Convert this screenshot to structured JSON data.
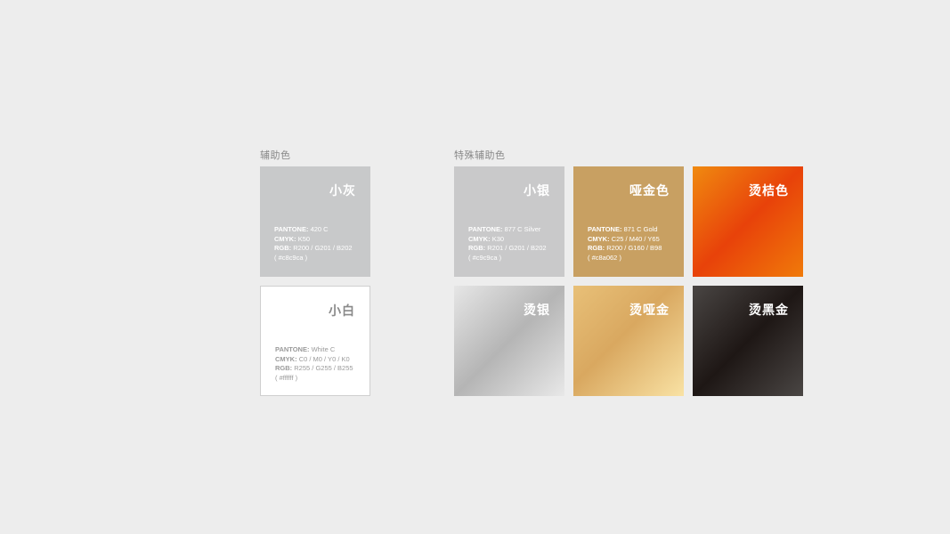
{
  "sections": {
    "aux_label": "辅助色",
    "special_label": "特殊辅助色"
  },
  "swatches": {
    "gray": {
      "name": "小灰",
      "pantone": "420 C",
      "cmyk": "K50",
      "rgb": "R200 / G201 / B202",
      "hex": "( #c8c9ca )",
      "color": "#c8c9ca"
    },
    "white": {
      "name": "小白",
      "pantone": "White C",
      "cmyk": "C0 / M0 / Y0 / K0",
      "rgb": "R255 / G255 / B255",
      "hex": "( #ffffff )",
      "color": "#ffffff"
    },
    "silver": {
      "name": "小银",
      "pantone": "877 C Silver",
      "cmyk": "K30",
      "rgb": "R201 / G201 / B202",
      "hex": "( #c9c9ca )",
      "color": "#c9c9ca"
    },
    "matte_gold": {
      "name": "哑金色",
      "pantone": "871 C Gold",
      "cmyk": "C25 / M40 / Y65",
      "rgb": "R200 / G160 / B98",
      "hex": "( #c8a062 )",
      "color": "#c8a062"
    },
    "hot_orange": {
      "name": "烫桔色",
      "colors": [
        "#f08a10",
        "#e8420a",
        "#f07a0a"
      ]
    },
    "hot_silver": {
      "name": "烫银",
      "colors": [
        "#e6e6e6",
        "#b5b5b5",
        "#e8e8e8"
      ]
    },
    "hot_matte_gold": {
      "name": "烫哑金",
      "colors": [
        "#e8c078",
        "#d9a860",
        "#f9e2a4"
      ]
    },
    "hot_black_gold": {
      "name": "烫黑金",
      "colors": [
        "#4a4644",
        "#1e1715",
        "#4a4644"
      ]
    }
  },
  "labels": {
    "pantone": "PANTONE:",
    "cmyk": "CMYK:",
    "rgb": "RGB:"
  }
}
